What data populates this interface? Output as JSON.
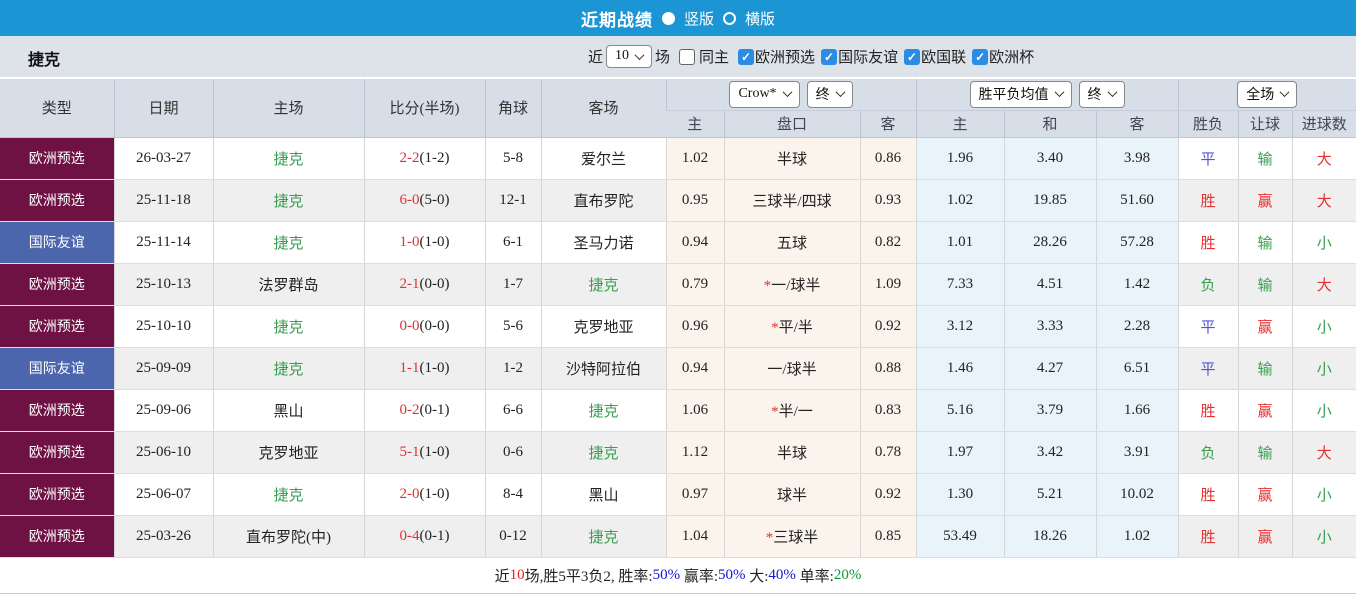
{
  "colors": {
    "topbar_blue": "#1c95d4",
    "type_maroon": "#6e1143",
    "type_blue": "#4b66ad",
    "team_green": "#3a9e50",
    "score_red": "#e53030",
    "draw_blue": "#5050d8",
    "footer_blue": "#1414d6",
    "footer_green": "#0a9a35",
    "odds_col_cream": "#faf4ec",
    "avg_col_lightblue": "#e9f3fa"
  },
  "title_bar": {
    "title": "近期战绩",
    "options": [
      {
        "label": "竖版",
        "selected": true
      },
      {
        "label": "横版",
        "selected": false
      }
    ]
  },
  "filter_bar": {
    "team": "捷克",
    "recent_label": "近",
    "recent_select_value": "10",
    "matches_label": "场",
    "same_home": {
      "label": "同主",
      "checked": false
    },
    "competitions": [
      {
        "label": "欧洲预选",
        "checked": true
      },
      {
        "label": "国际友谊",
        "checked": true
      },
      {
        "label": "欧国联",
        "checked": true
      },
      {
        "label": "欧洲杯",
        "checked": true
      }
    ]
  },
  "table": {
    "headers": {
      "type": "类型",
      "date": "日期",
      "home": "主场",
      "score": "比分(半场)",
      "corner": "角球",
      "away": "客场"
    },
    "selects": {
      "odds_company": "Crow*",
      "odds_time1": "终",
      "avg_metric": "胜平负均值",
      "odds_time2": "终",
      "scope": "全场"
    },
    "sub_headers": {
      "odds_home": "主",
      "handicap": "盘口",
      "odds_away": "客",
      "avg_home": "主",
      "avg_draw": "和",
      "avg_away": "客",
      "result": "胜负",
      "handicap_result": "让球",
      "goals": "进球数"
    },
    "rows": [
      {
        "type": "欧洲预选",
        "tc": "m",
        "date": "26-03-27",
        "home": "捷克",
        "hg": true,
        "ft": "2-2",
        "hts": "(1-2)",
        "corner": "5-8",
        "away": "爱尔兰",
        "ag": false,
        "oh": "1.02",
        "star": false,
        "hcap": "半球",
        "oa": "0.86",
        "ah": "1.96",
        "ad": "3.40",
        "aa": "3.98",
        "res": "平",
        "resc": "b",
        "let": "输",
        "letc": "g",
        "ou": "大",
        "ouc": "r"
      },
      {
        "type": "欧洲预选",
        "tc": "m",
        "date": "25-11-18",
        "home": "捷克",
        "hg": true,
        "ft": "6-0",
        "hts": "(5-0)",
        "corner": "12-1",
        "away": "直布罗陀",
        "ag": false,
        "oh": "0.95",
        "star": false,
        "hcap": "三球半/四球",
        "oa": "0.93",
        "ah": "1.02",
        "ad": "19.85",
        "aa": "51.60",
        "res": "胜",
        "resc": "r",
        "let": "赢",
        "letc": "r",
        "ou": "大",
        "ouc": "r"
      },
      {
        "type": "国际友谊",
        "tc": "b",
        "date": "25-11-14",
        "home": "捷克",
        "hg": true,
        "ft": "1-0",
        "hts": "(1-0)",
        "corner": "6-1",
        "away": "圣马力诺",
        "ag": false,
        "oh": "0.94",
        "star": false,
        "hcap": "五球",
        "oa": "0.82",
        "ah": "1.01",
        "ad": "28.26",
        "aa": "57.28",
        "res": "胜",
        "resc": "r",
        "let": "输",
        "letc": "g",
        "ou": "小",
        "ouc": "g"
      },
      {
        "type": "欧洲预选",
        "tc": "m",
        "date": "25-10-13",
        "home": "法罗群岛",
        "hg": false,
        "ft": "2-1",
        "hts": "(0-0)",
        "corner": "1-7",
        "away": "捷克",
        "ag": true,
        "oh": "0.79",
        "star": true,
        "hcap": "一/球半",
        "oa": "1.09",
        "ah": "7.33",
        "ad": "4.51",
        "aa": "1.42",
        "res": "负",
        "resc": "g",
        "let": "输",
        "letc": "g",
        "ou": "大",
        "ouc": "r"
      },
      {
        "type": "欧洲预选",
        "tc": "m",
        "date": "25-10-10",
        "home": "捷克",
        "hg": true,
        "ft": "0-0",
        "hts": "(0-0)",
        "corner": "5-6",
        "away": "克罗地亚",
        "ag": false,
        "oh": "0.96",
        "star": true,
        "hcap": "平/半",
        "oa": "0.92",
        "ah": "3.12",
        "ad": "3.33",
        "aa": "2.28",
        "res": "平",
        "resc": "b",
        "let": "赢",
        "letc": "r",
        "ou": "小",
        "ouc": "g"
      },
      {
        "type": "国际友谊",
        "tc": "b",
        "date": "25-09-09",
        "home": "捷克",
        "hg": true,
        "ft": "1-1",
        "hts": "(1-0)",
        "corner": "1-2",
        "away": "沙特阿拉伯",
        "ag": false,
        "oh": "0.94",
        "star": false,
        "hcap": "一/球半",
        "oa": "0.88",
        "ah": "1.46",
        "ad": "4.27",
        "aa": "6.51",
        "res": "平",
        "resc": "b",
        "let": "输",
        "letc": "g",
        "ou": "小",
        "ouc": "g"
      },
      {
        "type": "欧洲预选",
        "tc": "m",
        "date": "25-09-06",
        "home": "黑山",
        "hg": false,
        "ft": "0-2",
        "hts": "(0-1)",
        "corner": "6-6",
        "away": "捷克",
        "ag": true,
        "oh": "1.06",
        "star": true,
        "hcap": "半/一",
        "oa": "0.83",
        "ah": "5.16",
        "ad": "3.79",
        "aa": "1.66",
        "res": "胜",
        "resc": "r",
        "let": "赢",
        "letc": "r",
        "ou": "小",
        "ouc": "g"
      },
      {
        "type": "欧洲预选",
        "tc": "m",
        "date": "25-06-10",
        "home": "克罗地亚",
        "hg": false,
        "ft": "5-1",
        "hts": "(1-0)",
        "corner": "0-6",
        "away": "捷克",
        "ag": true,
        "oh": "1.12",
        "star": false,
        "hcap": "半球",
        "oa": "0.78",
        "ah": "1.97",
        "ad": "3.42",
        "aa": "3.91",
        "res": "负",
        "resc": "g",
        "let": "输",
        "letc": "g",
        "ou": "大",
        "ouc": "r"
      },
      {
        "type": "欧洲预选",
        "tc": "m",
        "date": "25-06-07",
        "home": "捷克",
        "hg": true,
        "ft": "2-0",
        "hts": "(1-0)",
        "corner": "8-4",
        "away": "黑山",
        "ag": false,
        "oh": "0.97",
        "star": false,
        "hcap": "球半",
        "oa": "0.92",
        "ah": "1.30",
        "ad": "5.21",
        "aa": "10.02",
        "res": "胜",
        "resc": "r",
        "let": "赢",
        "letc": "r",
        "ou": "小",
        "ouc": "g"
      },
      {
        "type": "欧洲预选",
        "tc": "m",
        "date": "25-03-26",
        "home": "直布罗陀(中)",
        "hg": false,
        "ft": "0-4",
        "hts": "(0-1)",
        "corner": "0-12",
        "away": "捷克",
        "ag": true,
        "oh": "1.04",
        "star": true,
        "hcap": "三球半",
        "oa": "0.85",
        "ah": "53.49",
        "ad": "18.26",
        "aa": "1.02",
        "res": "胜",
        "resc": "r",
        "let": "赢",
        "letc": "r",
        "ou": "小",
        "ouc": "g"
      }
    ]
  },
  "footer": {
    "segments": [
      {
        "text": "近",
        "color": "default"
      },
      {
        "text": "10",
        "color": "red"
      },
      {
        "text": "场,胜5平3负2, 胜率:",
        "color": "default"
      },
      {
        "text": "50%",
        "color": "blue"
      },
      {
        "text": " 赢率:",
        "color": "default"
      },
      {
        "text": "50%",
        "color": "blue"
      },
      {
        "text": " 大:",
        "color": "default"
      },
      {
        "text": "40%",
        "color": "blue"
      },
      {
        "text": " 单率:",
        "color": "default"
      },
      {
        "text": "20%",
        "color": "green"
      }
    ]
  }
}
